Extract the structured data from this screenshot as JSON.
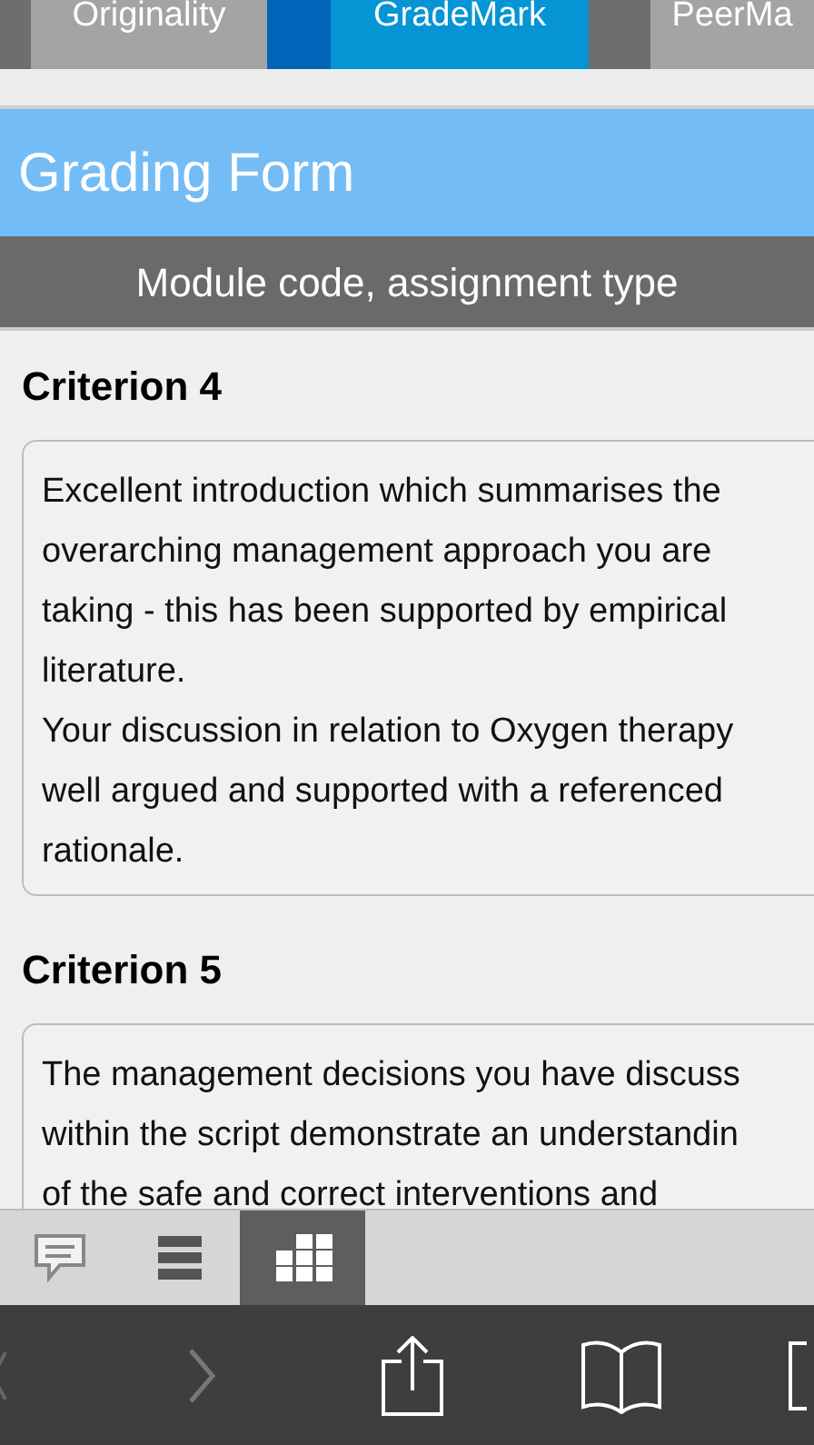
{
  "tabs": [
    {
      "label": "Originality",
      "selected": false
    },
    {
      "label": "GradeMark",
      "selected": true
    },
    {
      "label": "PeerMa",
      "selected": false
    }
  ],
  "header": {
    "title": "Grading Form",
    "subtitle": "Module code, assignment type"
  },
  "criteria": [
    {
      "title": "Criterion 4",
      "lines": [
        "Excellent introduction which summarises the",
        "overarching management approach you are",
        "taking - this has been supported by empirical",
        "literature.",
        "Your discussion in relation to Oxygen therapy",
        "well argued and supported with a referenced",
        "rationale."
      ]
    },
    {
      "title": "Criterion 5",
      "lines": [
        "The management decisions you have discuss",
        "within the script demonstrate an understandin",
        "of the safe and correct interventions and"
      ]
    }
  ],
  "toolbar": [
    {
      "kind": "comment",
      "selected": false
    },
    {
      "kind": "list",
      "selected": false
    },
    {
      "kind": "grid",
      "selected": true
    }
  ]
}
